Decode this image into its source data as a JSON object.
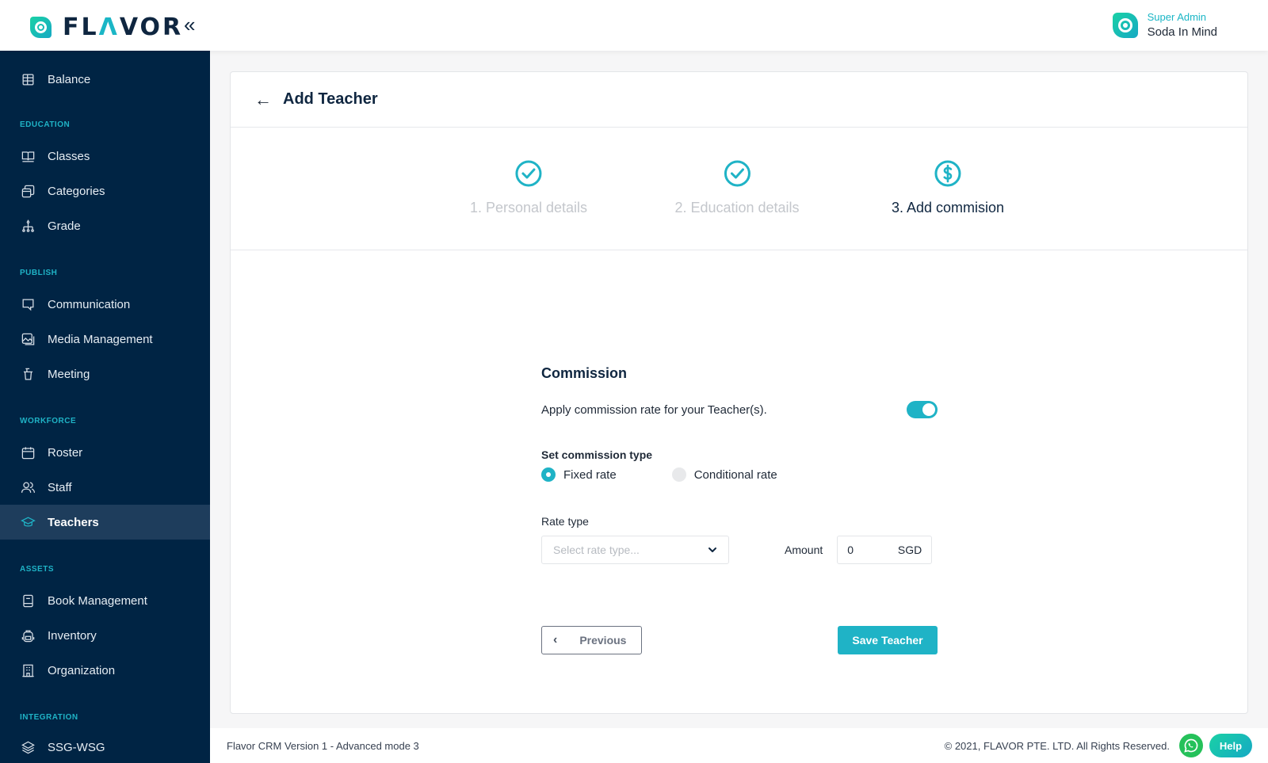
{
  "app": {
    "brand": "FLAVOR"
  },
  "header": {
    "collapse_icon": "double-chevron-left-icon",
    "user": {
      "role": "Super Admin",
      "name": "Soda In Mind"
    }
  },
  "sidebar": {
    "sections": [
      {
        "title": "",
        "items": [
          {
            "label": "Balance",
            "icon": "balance-icon"
          }
        ]
      },
      {
        "title": "EDUCATION",
        "items": [
          {
            "label": "Classes",
            "icon": "book-open-icon"
          },
          {
            "label": "Categories",
            "icon": "stack-icon"
          },
          {
            "label": "Grade",
            "icon": "hierarchy-icon"
          }
        ]
      },
      {
        "title": "PUBLISH",
        "items": [
          {
            "label": "Communication",
            "icon": "chat-icon"
          },
          {
            "label": "Media Management",
            "icon": "image-icon"
          },
          {
            "label": "Meeting",
            "icon": "podium-icon"
          }
        ]
      },
      {
        "title": "WORKFORCE",
        "items": [
          {
            "label": "Roster",
            "icon": "calendar-icon"
          },
          {
            "label": "Staff",
            "icon": "users-icon"
          },
          {
            "label": "Teachers",
            "icon": "graduation-cap-icon",
            "active": true
          }
        ]
      },
      {
        "title": "ASSETS",
        "items": [
          {
            "label": "Book Management",
            "icon": "book-icon"
          },
          {
            "label": "Inventory",
            "icon": "backpack-icon"
          },
          {
            "label": "Organization",
            "icon": "building-icon"
          }
        ]
      },
      {
        "title": "INTEGRATION",
        "items": [
          {
            "label": "SSG-WSG",
            "icon": "layers-icon"
          }
        ]
      }
    ]
  },
  "page": {
    "title": "Add Teacher",
    "steps": [
      {
        "label": "1. Personal details",
        "state": "done",
        "icon": "check-circle-icon"
      },
      {
        "label": "2. Education details",
        "state": "done",
        "icon": "check-circle-icon"
      },
      {
        "label": "3. Add commision",
        "state": "current",
        "icon": "dollar-circle-icon"
      }
    ],
    "form": {
      "title": "Commission",
      "toggle_label": "Apply commission rate for your Teacher(s).",
      "toggle_on": true,
      "type_label": "Set commission type",
      "options": [
        {
          "label": "Fixed rate",
          "checked": true
        },
        {
          "label": "Conditional rate",
          "checked": false
        }
      ],
      "rate_type_label": "Rate type",
      "rate_type_placeholder": "Select rate type...",
      "amount_label": "Amount",
      "amount_value": "0",
      "currency": "SGD",
      "prev_label": "Previous",
      "save_label": "Save Teacher"
    }
  },
  "footer": {
    "version": "Flavor CRM Version 1 - Advanced mode 3",
    "copyright": "© 2021, FLAVOR PTE. LTD. All Rights Reserved.",
    "help_label": "Help"
  },
  "colors": {
    "accent": "#1fb3c6",
    "sidebar": "#002444",
    "active_item": "#1e3d5c",
    "whatsapp": "#25c15a"
  }
}
